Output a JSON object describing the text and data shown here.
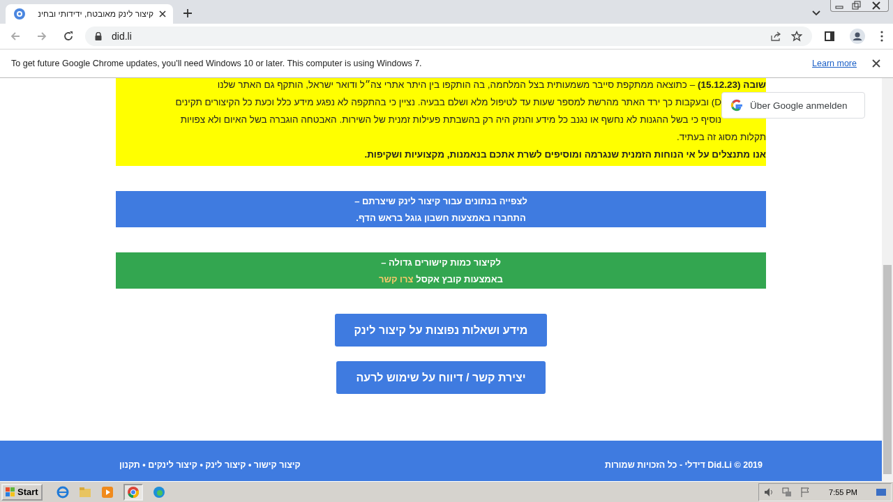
{
  "browser": {
    "tab_title": "קיצור לינק מאובטח, ידידותי ובחינ",
    "url": "did.li",
    "infobar": {
      "message": "To get future Google Chrome updates, you'll need Windows 10 or later. This computer is using Windows 7.",
      "link": "Learn more"
    }
  },
  "google_signin": {
    "label": "Über Google anmelden"
  },
  "notice": {
    "lines": [
      {
        "kind": "lead",
        "text": "**שובה (15.12.23)** – כתוצאה ממתקפת סייבר משמעותית בצל המלחמה, בה הותקפו בין היתר אתרי צה״ל ודואר ישראל, הותקף גם האתר שלנו"
      },
      {
        "kind": "covered",
        "text": "D) ובעקבות כך ירד האתר מהרשת למספר שעות עד לטיפול מלא ושלם בבעיה. נציין כי בהתקפה לא נפגע מידע כלל וכעת כל הקיצורים תקינים"
      },
      {
        "kind": "covered",
        "text": "נוסיף כי בשל ההגנות לא נחשף או נגנב כל מידע והנזק היה רק בהשבתת פעילות זמנית של השירות. האבטחה הוגברה בשל האיום ולא צפויות"
      },
      {
        "kind": "plain",
        "text": "תקלות מסוג זה בעתיד."
      },
      {
        "kind": "bold",
        "text": "אנו מתנצלים על אי הנוחות הזמנית שנגרמה ומוסיפים לשרת אתכם בנאמנות, מקצועיות ושקיפות."
      }
    ]
  },
  "banners": [
    {
      "color": "#3f7be0",
      "lines": [
        "לצפייה בנתונים עבור קיצור לינק שיצרתם –",
        "התחברו באמצעות חשבון גוגל בראש הדף."
      ]
    },
    {
      "color": "#33a650",
      "lines": [
        "לקיצור כמות קישורים גדולה –",
        "באמצעות קובץ אקסל"
      ],
      "link": "צרו קשר"
    }
  ],
  "buttons": [
    "מידע ושאלות נפוצות על קיצור לינק",
    "יצירת קשר / דיווח על שימוש לרעה"
  ],
  "footer": {
    "links": "קיצור קישור • קיצור לינק • קיצור לינקים • תקנון",
    "copyright": "Did.Li © 2019 דידלי - כל הזכויות שמורות"
  },
  "taskbar": {
    "start": "Start",
    "clock": "7:55 PM"
  }
}
